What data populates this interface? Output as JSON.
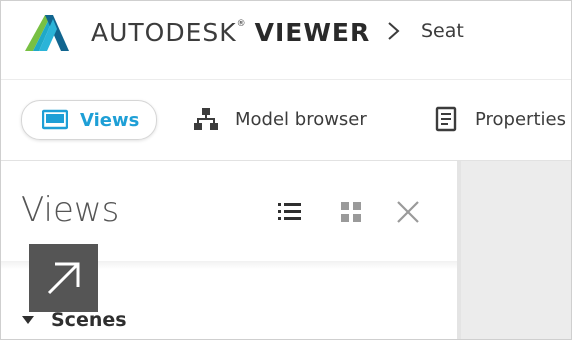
{
  "header": {
    "brand_light": "AUTODESK",
    "brand_reg": "®",
    "brand_bold": "VIEWER",
    "breadcrumb_sep_icon": "chevron-right-icon",
    "breadcrumb_current": "Seat"
  },
  "tabs": [
    {
      "label": "Views",
      "icon": "views-icon",
      "active": true
    },
    {
      "label": "Model browser",
      "icon": "hierarchy-icon",
      "active": false
    },
    {
      "label": "Properties",
      "icon": "properties-icon",
      "active": false
    }
  ],
  "panel": {
    "title": "Views",
    "list_view_icon": "list-icon",
    "grid_view_icon": "grid-icon",
    "close_icon": "close-icon",
    "section_label": "Scenes",
    "section_caret": "caret-down-icon"
  },
  "overlay": {
    "icon": "expand-arrow-icon"
  },
  "colors": {
    "accent": "#1e9fd6",
    "logo_teal": "#1fa9c8",
    "logo_green": "#78c043",
    "logo_dark": "#11658f",
    "text": "#3c3c3c",
    "tile": "#555555",
    "viewport": "#ececec"
  }
}
